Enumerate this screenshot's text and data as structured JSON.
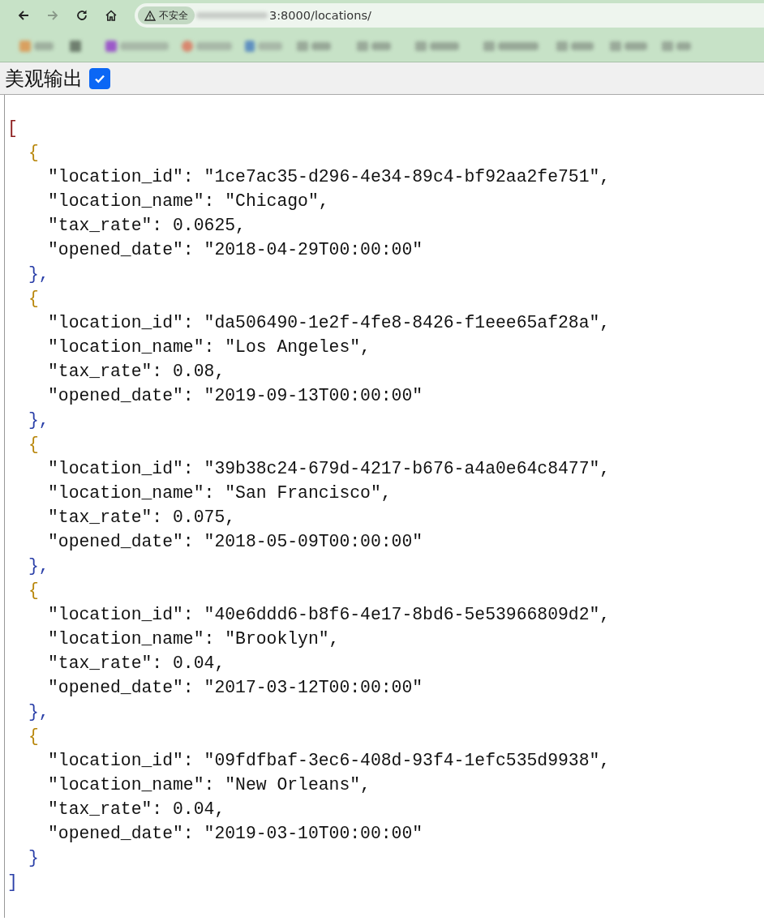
{
  "browser": {
    "back_disabled": false,
    "forward_disabled": true,
    "security_label": "不安全",
    "url_visible": "3:8000/locations/"
  },
  "toolbar": {
    "label": "美观输出",
    "checked": true
  },
  "json": {
    "open": "[",
    "close": "]",
    "items": [
      {
        "open": "{",
        "close": "},",
        "fields": [
          "\"location_id\": \"1ce7ac35-d296-4e34-89c4-bf92aa2fe751\",",
          "\"location_name\": \"Chicago\",",
          "\"tax_rate\": 0.0625,",
          "\"opened_date\": \"2018-04-29T00:00:00\""
        ]
      },
      {
        "open": "{",
        "close": "},",
        "fields": [
          "\"location_id\": \"da506490-1e2f-4fe8-8426-f1eee65af28a\",",
          "\"location_name\": \"Los Angeles\",",
          "\"tax_rate\": 0.08,",
          "\"opened_date\": \"2019-09-13T00:00:00\""
        ]
      },
      {
        "open": "{",
        "close": "},",
        "fields": [
          "\"location_id\": \"39b38c24-679d-4217-b676-a4a0e64c8477\",",
          "\"location_name\": \"San Francisco\",",
          "\"tax_rate\": 0.075,",
          "\"opened_date\": \"2018-05-09T00:00:00\""
        ]
      },
      {
        "open": "{",
        "close": "},",
        "fields": [
          "\"location_id\": \"40e6ddd6-b8f6-4e17-8bd6-5e53966809d2\",",
          "\"location_name\": \"Brooklyn\",",
          "\"tax_rate\": 0.04,",
          "\"opened_date\": \"2017-03-12T00:00:00\""
        ]
      },
      {
        "open": "{",
        "close": "}",
        "fields": [
          "\"location_id\": \"09fdfbaf-3ec6-408d-93f4-1efc535d9938\",",
          "\"location_name\": \"New Orleans\",",
          "\"tax_rate\": 0.04,",
          "\"opened_date\": \"2019-03-10T00:00:00\""
        ]
      }
    ]
  }
}
